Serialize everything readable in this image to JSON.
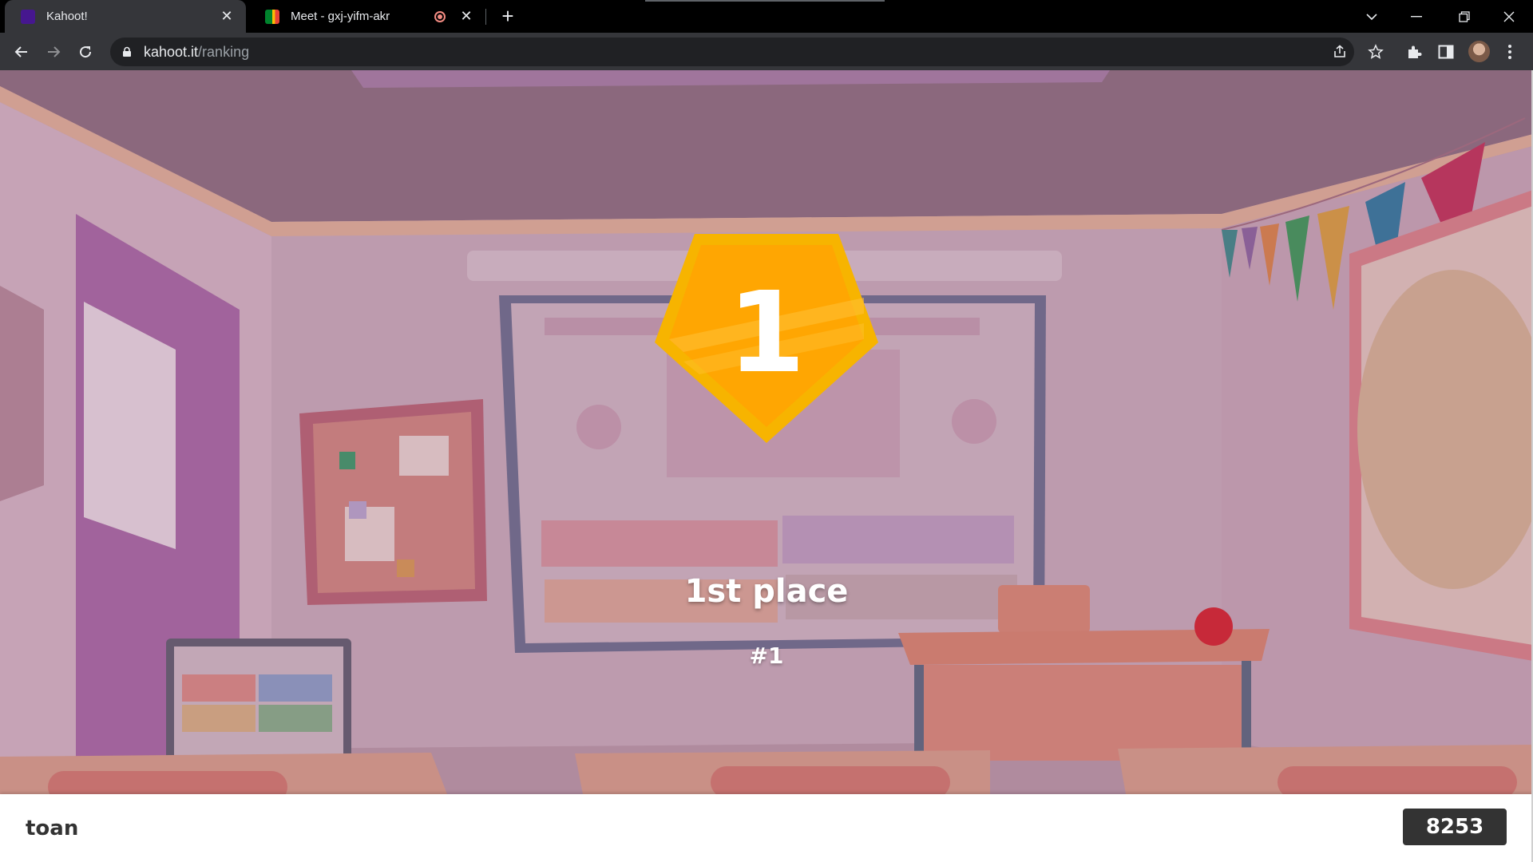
{
  "browser": {
    "tabs": [
      {
        "title": "Kahoot!",
        "active": true,
        "favicon_color": "#46178f"
      },
      {
        "title": "Meet - gxj-yifm-akr",
        "active": false,
        "recording": true,
        "favicon_color": "#00832d"
      }
    ],
    "address": {
      "domain": "kahoot.it",
      "path": "/ranking"
    },
    "icons": [
      "back-icon",
      "forward-icon",
      "reload-icon",
      "lock-icon",
      "share-icon",
      "bookmark-star-icon",
      "extensions-icon",
      "side-panel-icon",
      "profile-avatar",
      "menu-icon",
      "tab-search-icon",
      "minimize-icon",
      "restore-icon",
      "close-icon",
      "new-tab-icon"
    ]
  },
  "result": {
    "podium_number": "1",
    "place_label": "1st place",
    "rank_label": "#1",
    "podium_color": "#ffa602"
  },
  "footer": {
    "player_name": "toan",
    "score": "8253"
  }
}
